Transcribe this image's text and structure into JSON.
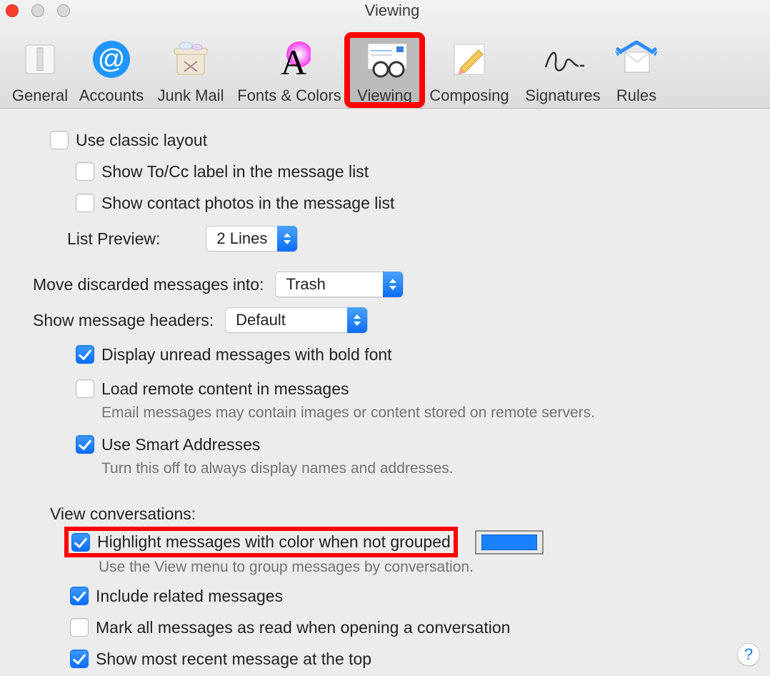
{
  "window": {
    "title": "Viewing"
  },
  "toolbar": {
    "general": "General",
    "accounts": "Accounts",
    "junk": "Junk Mail",
    "fonts": "Fonts & Colors",
    "viewing": "Viewing",
    "composing": "Composing",
    "signatures": "Signatures",
    "rules": "Rules"
  },
  "opts": {
    "classic": "Use classic layout",
    "show_tocc": "Show To/Cc label in the message list",
    "show_photos": "Show contact photos in the message list",
    "list_preview_label": "List Preview:",
    "list_preview_value": "2 Lines",
    "move_discarded_label": "Move discarded messages into:",
    "move_discarded_value": "Trash",
    "headers_label": "Show message headers:",
    "headers_value": "Default",
    "display_bold": "Display unread messages with bold font",
    "load_remote": "Load remote content in messages",
    "load_remote_sub": "Email messages may contain images or content stored on remote servers.",
    "smart_addr": "Use Smart Addresses",
    "smart_addr_sub": "Turn this off to always display names and addresses."
  },
  "conv": {
    "section": "View conversations:",
    "highlight": "Highlight messages with color when not grouped",
    "highlight_sub": "Use the View menu to group messages by conversation.",
    "highlight_color": "#1a82ff",
    "include_related": "Include related messages",
    "mark_read": "Mark all messages as read when opening a conversation",
    "recent_top": "Show most recent message at the top"
  },
  "help": "?"
}
